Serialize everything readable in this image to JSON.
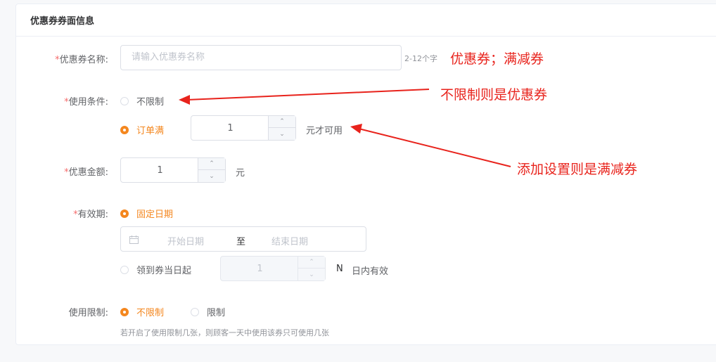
{
  "section": {
    "title": "优惠券券面信息"
  },
  "name_field": {
    "required_mark": "*",
    "label": "优惠券名称:",
    "placeholder": "请输入优惠券名称",
    "hint": "2-12个字"
  },
  "condition": {
    "required_mark": "*",
    "label": "使用条件:",
    "option_unlimited": "不限制",
    "option_order_full": "订单满",
    "threshold_value": "1",
    "suffix": "元才可用"
  },
  "discount": {
    "required_mark": "*",
    "label": "优惠金额:",
    "value": "1",
    "unit": "元"
  },
  "validity": {
    "required_mark": "*",
    "label": "有效期:",
    "option_fixed": "固定日期",
    "start_placeholder": "开始日期",
    "separator": "至",
    "end_placeholder": "结束日期",
    "option_relative": "领到券当日起",
    "days_value": "1",
    "days_unit": "N",
    "days_suffix": "日内有效"
  },
  "usage_limit": {
    "label": "使用限制:",
    "option_unlimited": "不限制",
    "option_limited": "限制",
    "hint": "若开启了使用限制几张，则顾客一天中使用该券只可使用几张"
  },
  "annotations": {
    "types": "优惠券；满减券",
    "unlimited_note": "不限制则是优惠券",
    "threshold_note": "添加设置则是满减券"
  },
  "colors": {
    "accent": "#f4871f",
    "required": "#f56c6c",
    "annotation": "#e8231c"
  },
  "icons": {
    "calendar": "calendar-icon",
    "spin_up": "chevron-up-icon",
    "spin_down": "chevron-down-icon"
  }
}
